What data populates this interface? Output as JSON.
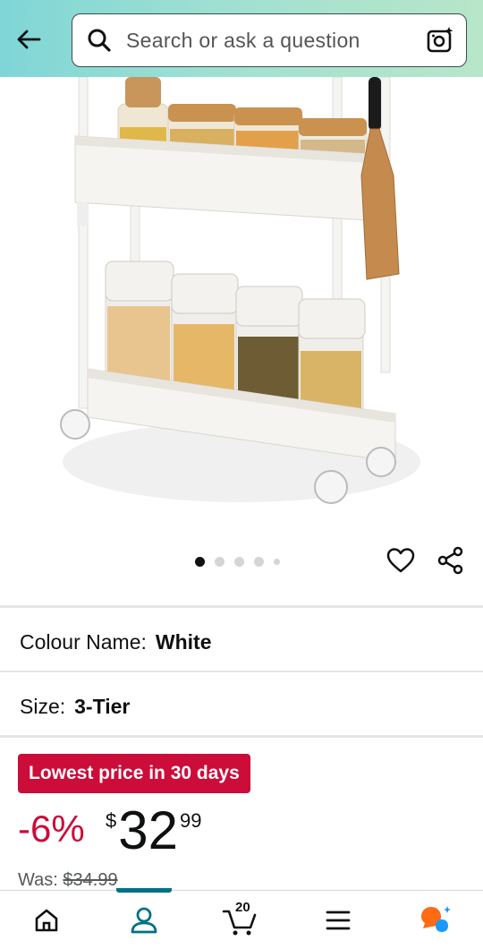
{
  "header": {
    "search_placeholder": "Search or ask a question"
  },
  "product": {
    "carousel_total": 5,
    "carousel_active": 1
  },
  "variations": {
    "colour": {
      "label": "Colour Name:",
      "value": "White"
    },
    "size": {
      "label": "Size:",
      "value": "3-Tier"
    }
  },
  "pricing": {
    "badge": "Lowest price in 30 days",
    "discount": "-6%",
    "currency": "$",
    "whole": "32",
    "fraction": "99",
    "was_label": "Was:",
    "was_price": "$34.99"
  },
  "bottom_nav": {
    "cart_count": "20",
    "active_tab": "account"
  },
  "colors": {
    "header_accent": "#8edbd3",
    "deal_red": "#cc0c39",
    "nav_active": "#007185",
    "rufus_orange": "#ff6a14",
    "rufus_blue": "#1a98ff"
  },
  "icons": [
    "back-arrow-icon",
    "search-icon",
    "camera-icon",
    "heart-icon",
    "share-icon",
    "home-icon",
    "account-icon",
    "cart-icon",
    "menu-icon",
    "rufus-icon"
  ]
}
